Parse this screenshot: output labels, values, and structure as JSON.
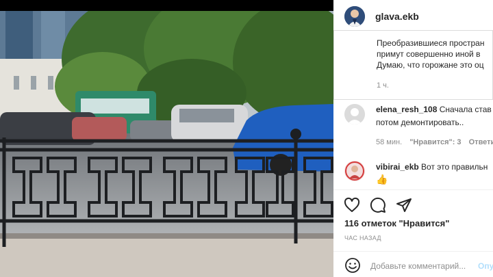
{
  "post": {
    "username": "glava.ekb",
    "caption_lines": [
      "Преобразившиеся простран",
      "примут совершенно иной в",
      "Думаю, что горожане это оц"
    ],
    "caption_time": "1 ч."
  },
  "comments": [
    {
      "username": "elena_resh_108",
      "text_line1": "Сначала став",
      "text_line2": "потом демонтировать..",
      "time": "58 мин.",
      "likes": "\"Нравится\": 3",
      "reply": "Ответить"
    },
    {
      "username": "vibirai_ekb",
      "text_line1": "Вот это правильн",
      "emoji": "👍"
    }
  ],
  "actions": {
    "likes_text": "116 отметок \"Нравится\"",
    "posted_ago": "ЧАС НАЗАД",
    "comment_placeholder": "Добавьте комментарий...",
    "post_button": "Опубликовать"
  },
  "icons": {
    "like": "heart-icon",
    "comment": "comment-bubble-icon",
    "share": "paper-plane-icon",
    "emoji": "smiley-icon"
  },
  "colors": {
    "text": "#262626",
    "muted": "#8e8e8e",
    "post_button": "#b2dffc"
  }
}
